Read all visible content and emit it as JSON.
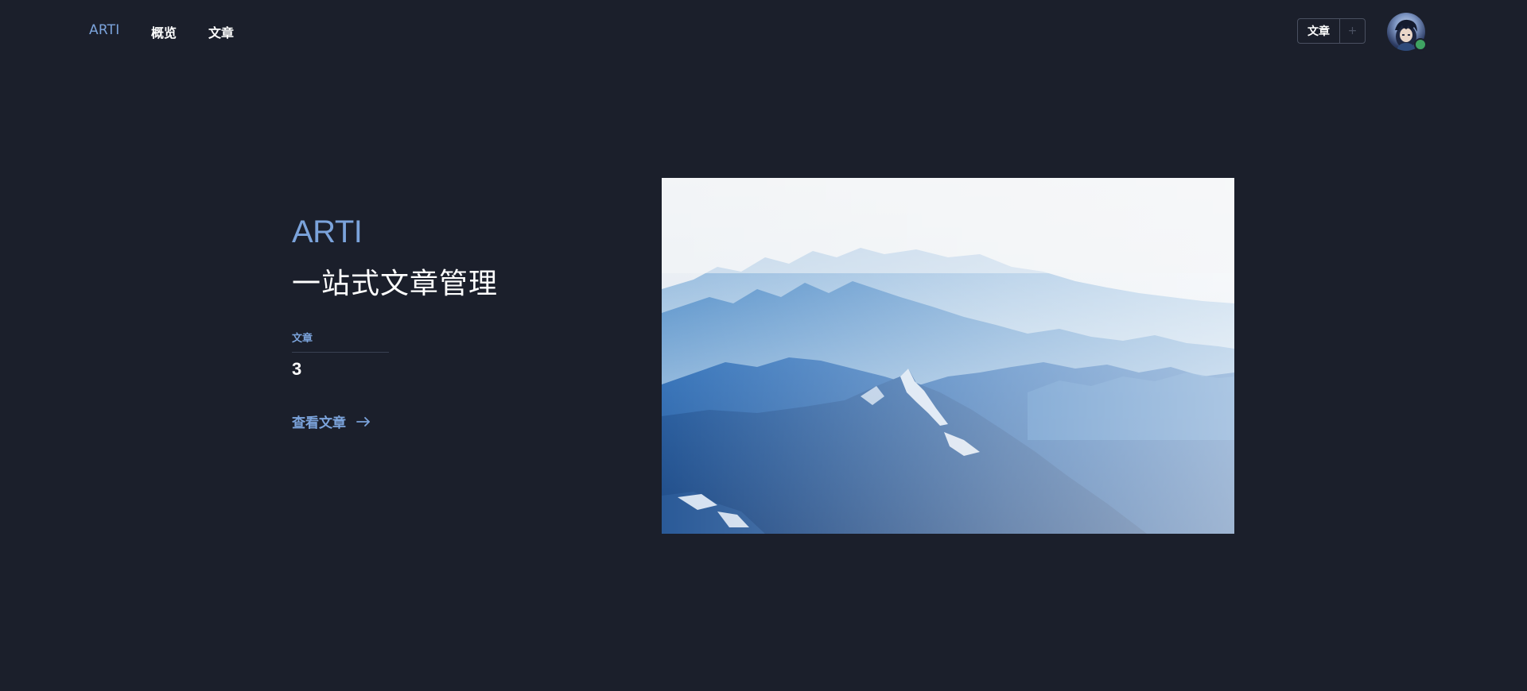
{
  "nav": {
    "brand": "ARTI",
    "links": [
      "概览",
      "文章"
    ]
  },
  "toolbar": {
    "articles_button": "文章",
    "add_button": "+"
  },
  "hero": {
    "brand": "ARTI",
    "tagline": "一站式文章管理",
    "stat_label": "文章",
    "stat_value": "3",
    "view_link": "查看文章"
  },
  "colors": {
    "accent": "#7ba3db",
    "background": "#1b1f2b",
    "online_status": "#3fa362"
  },
  "icons": {
    "arrow": "arrow-right-icon",
    "avatar": "user-avatar",
    "status": "online-status-dot"
  }
}
